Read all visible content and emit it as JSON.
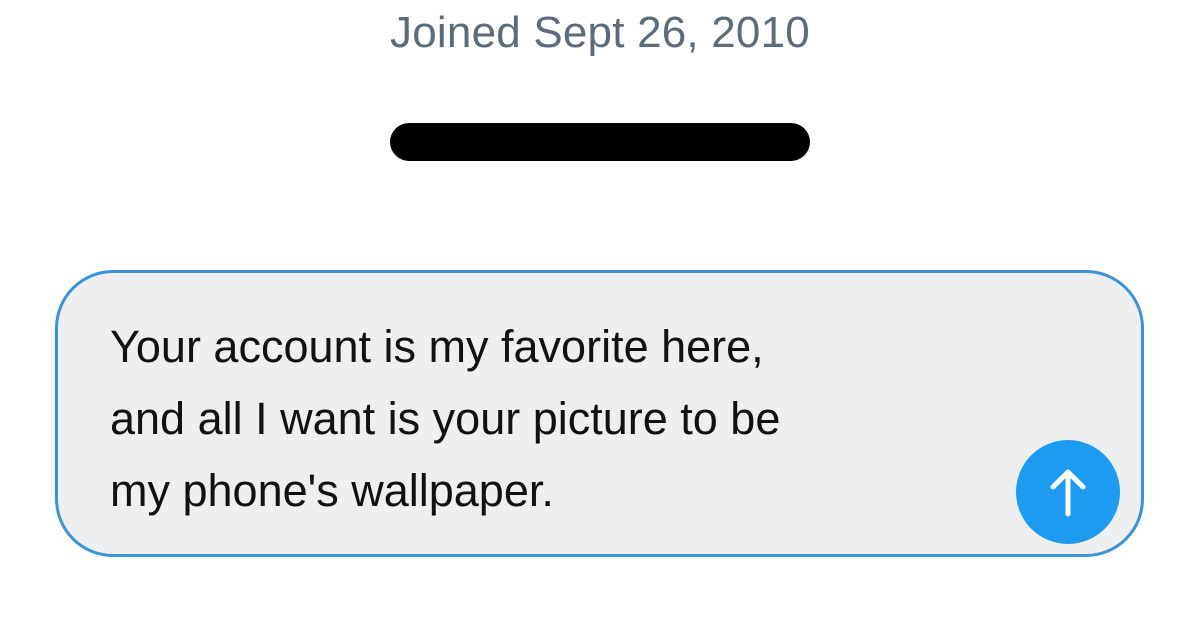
{
  "profile": {
    "joined_text": "Joined Sept 26, 2010"
  },
  "composer": {
    "message_text": "Your account is my favorite here,\nand all I want is  your picture to be\nmy phone's wallpaper.",
    "send_icon": "arrow-up-icon"
  },
  "colors": {
    "accent": "#1d9bf0",
    "composer_border": "#3a93d8",
    "composer_background": "#eeeff1",
    "muted_text": "#5b6b7a",
    "redaction": "#000000"
  }
}
